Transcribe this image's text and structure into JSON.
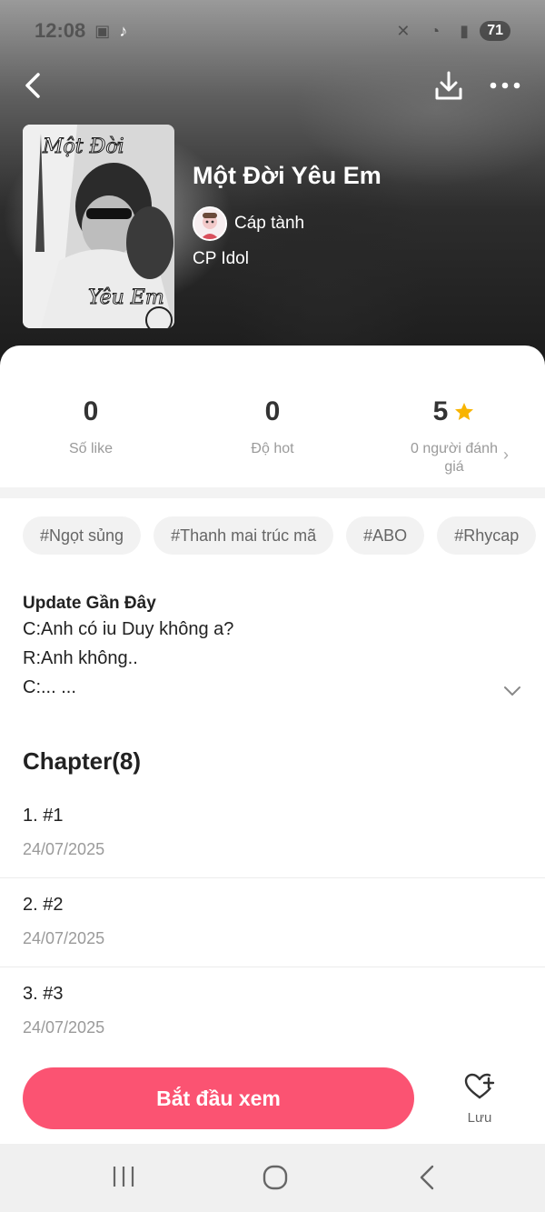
{
  "status_bar": {
    "time": "12:08",
    "battery": "71",
    "icons": [
      "screenshot-icon",
      "tiktok-icon",
      "mute-icon",
      "wifi-icon",
      "signal-icon"
    ]
  },
  "book": {
    "title": "Một Đời Yêu Em",
    "author": "Cáp tành",
    "category": "CP Idol",
    "cover_text_top": "Một Đời",
    "cover_text_bottom": "Yêu Em"
  },
  "stats": {
    "likes": {
      "value": "0",
      "label": "Số like"
    },
    "hot": {
      "value": "0",
      "label": "Độ hot"
    },
    "rating": {
      "value": "5",
      "label": "0 người đánh giá"
    }
  },
  "tags": [
    "#Ngọt sủng",
    "#Thanh mai trúc mã",
    "#ABO",
    "#Rhycap"
  ],
  "update": {
    "heading": "Update Gần Đây",
    "lines": [
      "C:Anh có iu Duy không a?",
      "R:Anh không..",
      "C:... ..."
    ]
  },
  "chapters": {
    "heading": "Chapter(8)",
    "items": [
      {
        "name": "1. #1",
        "date": "24/07/2025"
      },
      {
        "name": "2. #2",
        "date": "24/07/2025"
      },
      {
        "name": "3. #3",
        "date": "24/07/2025"
      }
    ]
  },
  "actions": {
    "start_label": "Bắt đầu xem",
    "save_label": "Lưu"
  },
  "colors": {
    "accent": "#fb5372",
    "star": "#f8b400"
  }
}
